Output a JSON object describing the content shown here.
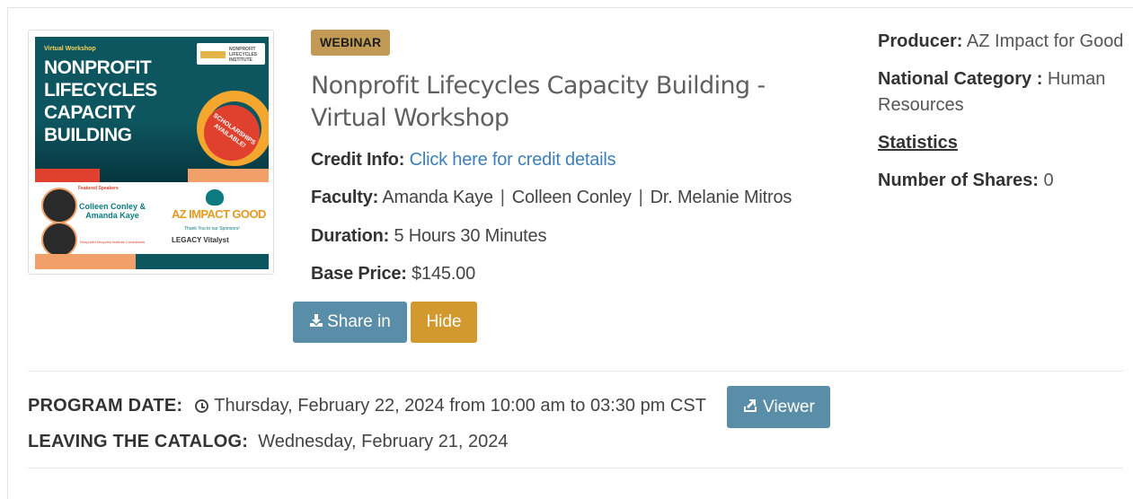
{
  "thumbnail": {
    "small_label": "Virtual Workshop",
    "title_lines": [
      "NONPROFIT",
      "LIFECYCLES",
      "CAPACITY",
      "BUILDING"
    ],
    "logo_text": "NONPROFIT LIFECYCLES INSTITUTE",
    "badge": "SCHOLARSHIPS AVAILABLE!",
    "featured_label": "Featured Speakers",
    "speakers": "Colleen Conley & Amanda Kaye",
    "speakers_sub": "Nonprofit Lifecycles Institute Consultants",
    "org_logo": "AZ IMPACT GOOD",
    "thank_you": "Thank You to our Sponsors!",
    "sponsors": "LEGACY  Vitalyst"
  },
  "course": {
    "type_badge": "WEBINAR",
    "title": "Nonprofit Lifecycles Capacity Building - Virtual Workshop",
    "credit_label": "Credit Info:",
    "credit_link": "Click here for credit details",
    "faculty_label": "Faculty:",
    "faculty": [
      "Amanda Kaye",
      "Colleen Conley",
      "Dr. Melanie Mitros"
    ],
    "faculty_sep": "|",
    "duration_label": "Duration:",
    "duration": "5 Hours 30 Minutes",
    "price_label": "Base Price:",
    "price": "$145.00"
  },
  "actions": {
    "share_label": "Share in",
    "hide_label": "Hide",
    "viewer_label": "Viewer"
  },
  "details": {
    "producer_label": "Producer:",
    "producer": "AZ Impact for Good",
    "category_label": "National Category :",
    "category": "Human Resources",
    "statistics_label": "Statistics",
    "shares_label": "Number of Shares:",
    "shares": "0"
  },
  "schedule": {
    "program_date_label": "PROGRAM DATE:",
    "program_date": "Thursday, February 22, 2024 from 10:00 am to 03:30 pm CST",
    "leaving_label": "LEAVING THE CATALOG:",
    "leaving_date": "Wednesday, February 21, 2024"
  },
  "colors": {
    "badge_bg": "#c19a55",
    "primary_button": "#5a8da8",
    "warning_button": "#d29a2e",
    "link": "#3d7fbd"
  }
}
